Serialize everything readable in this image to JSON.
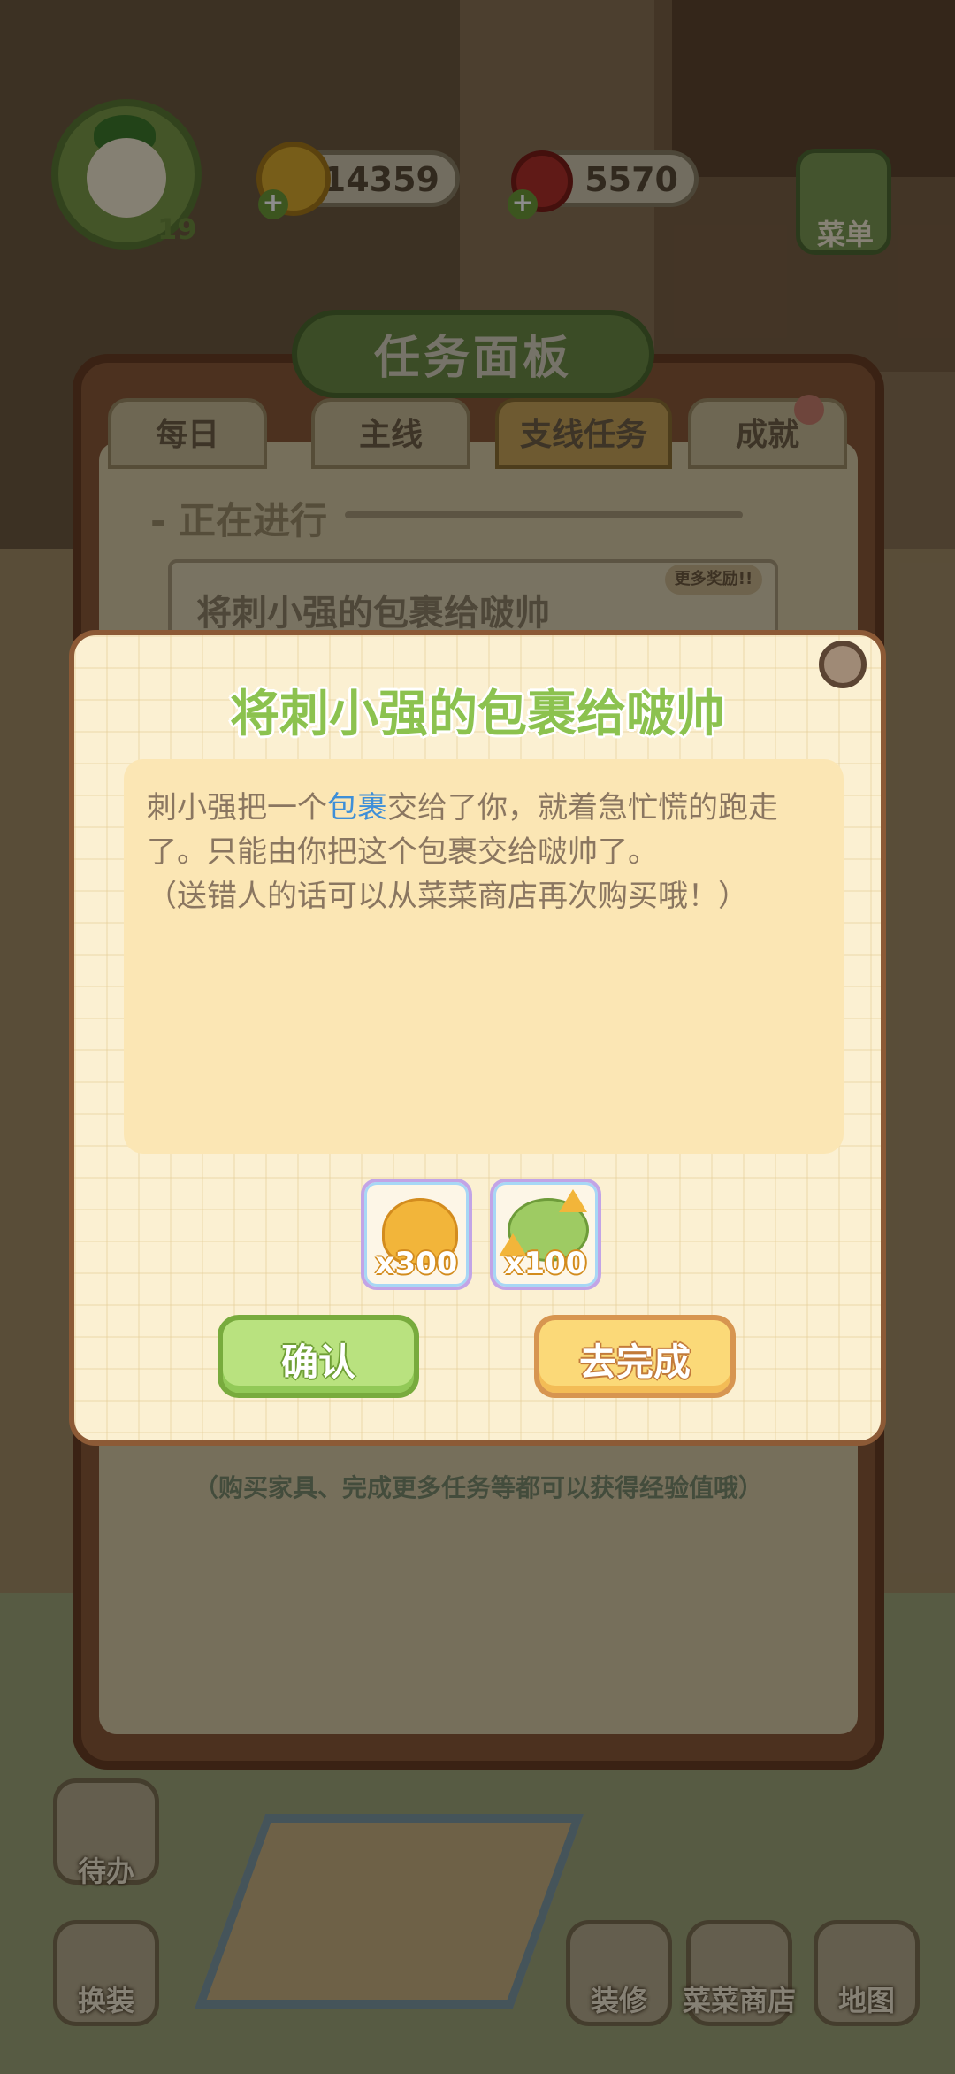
{
  "hud": {
    "level": "19",
    "coins": "14359",
    "veggies": "5570",
    "menu_label": "菜单"
  },
  "board": {
    "title": "任务面板",
    "tabs": [
      {
        "label": "每日"
      },
      {
        "label": "主线"
      },
      {
        "label": "支线任务"
      },
      {
        "label": "成就"
      }
    ],
    "active_tab": "支线任务",
    "in_progress_label": "- 正在进行",
    "current_task": "将刺小强的包裹给啵帅",
    "more_reward": "更多奖励!!",
    "exp_hint": "（购买家具、完成更多任务等都可以获得经验值哦）"
  },
  "popup": {
    "title": "将刺小强的包裹给啵帅",
    "desc_part1": "刺小强把一个",
    "desc_highlight": "包裹",
    "desc_part2": "交给了你，就着急忙慌的跑走了。只能由你把这个包裹交给啵帅了。",
    "desc_note": "（送错人的话可以从菜菜商店再次购买哦！）",
    "rewards": [
      {
        "name": "gold-coins",
        "qty": "x300"
      },
      {
        "name": "veggie-exp",
        "qty": "x100"
      }
    ],
    "confirm_label": "确认",
    "go_label": "去完成"
  },
  "nav": {
    "todo": "待办",
    "dress": "换装",
    "decorate": "装修",
    "shop": "菜菜商店",
    "map": "地图"
  },
  "colors": {
    "title_green": "#8cc24f",
    "highlight_blue": "#3e8fd8",
    "confirm_green": "#b9e27f",
    "go_yellow": "#fbd978"
  }
}
